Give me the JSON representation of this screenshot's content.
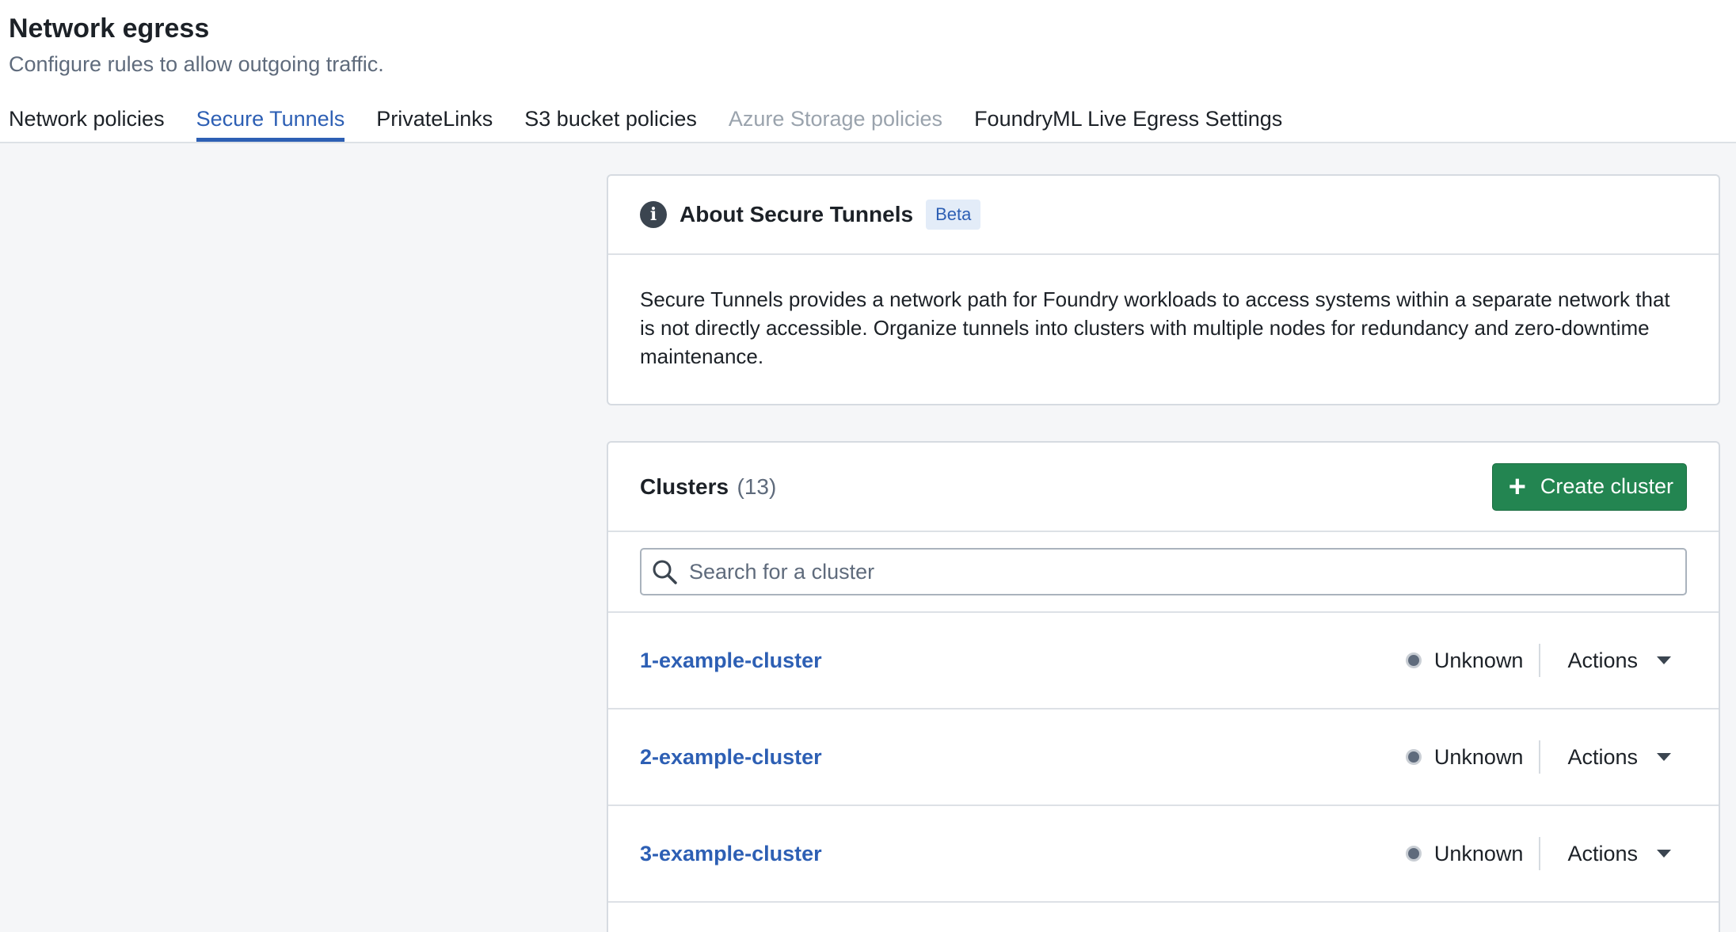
{
  "header": {
    "title": "Network egress",
    "subtitle": "Configure rules to allow outgoing traffic."
  },
  "tabs": [
    {
      "label": "Network policies",
      "state": "normal"
    },
    {
      "label": "Secure Tunnels",
      "state": "active"
    },
    {
      "label": "PrivateLinks",
      "state": "normal"
    },
    {
      "label": "S3 bucket policies",
      "state": "normal"
    },
    {
      "label": "Azure Storage policies",
      "state": "disabled"
    },
    {
      "label": "FoundryML Live Egress Settings",
      "state": "normal"
    }
  ],
  "about": {
    "icon": "info-icon",
    "title": "About Secure Tunnels",
    "badge": "Beta",
    "body": "Secure Tunnels provides a network path for Foundry workloads to access systems within a separate network that is not directly accessible. Organize tunnels into clusters with multiple nodes for redundancy and zero-downtime maintenance."
  },
  "clusters": {
    "title": "Clusters",
    "count": "(13)",
    "create_label": "Create cluster",
    "search_placeholder": "Search for a cluster",
    "actions_label": "Actions",
    "items": [
      {
        "name": "1-example-cluster",
        "status": "Unknown"
      },
      {
        "name": "2-example-cluster",
        "status": "Unknown"
      },
      {
        "name": "3-example-cluster",
        "status": "Unknown"
      }
    ]
  },
  "colors": {
    "accent": "#2d5fb4",
    "create_button": "#238551",
    "status_unknown": "#5f6b7c"
  }
}
